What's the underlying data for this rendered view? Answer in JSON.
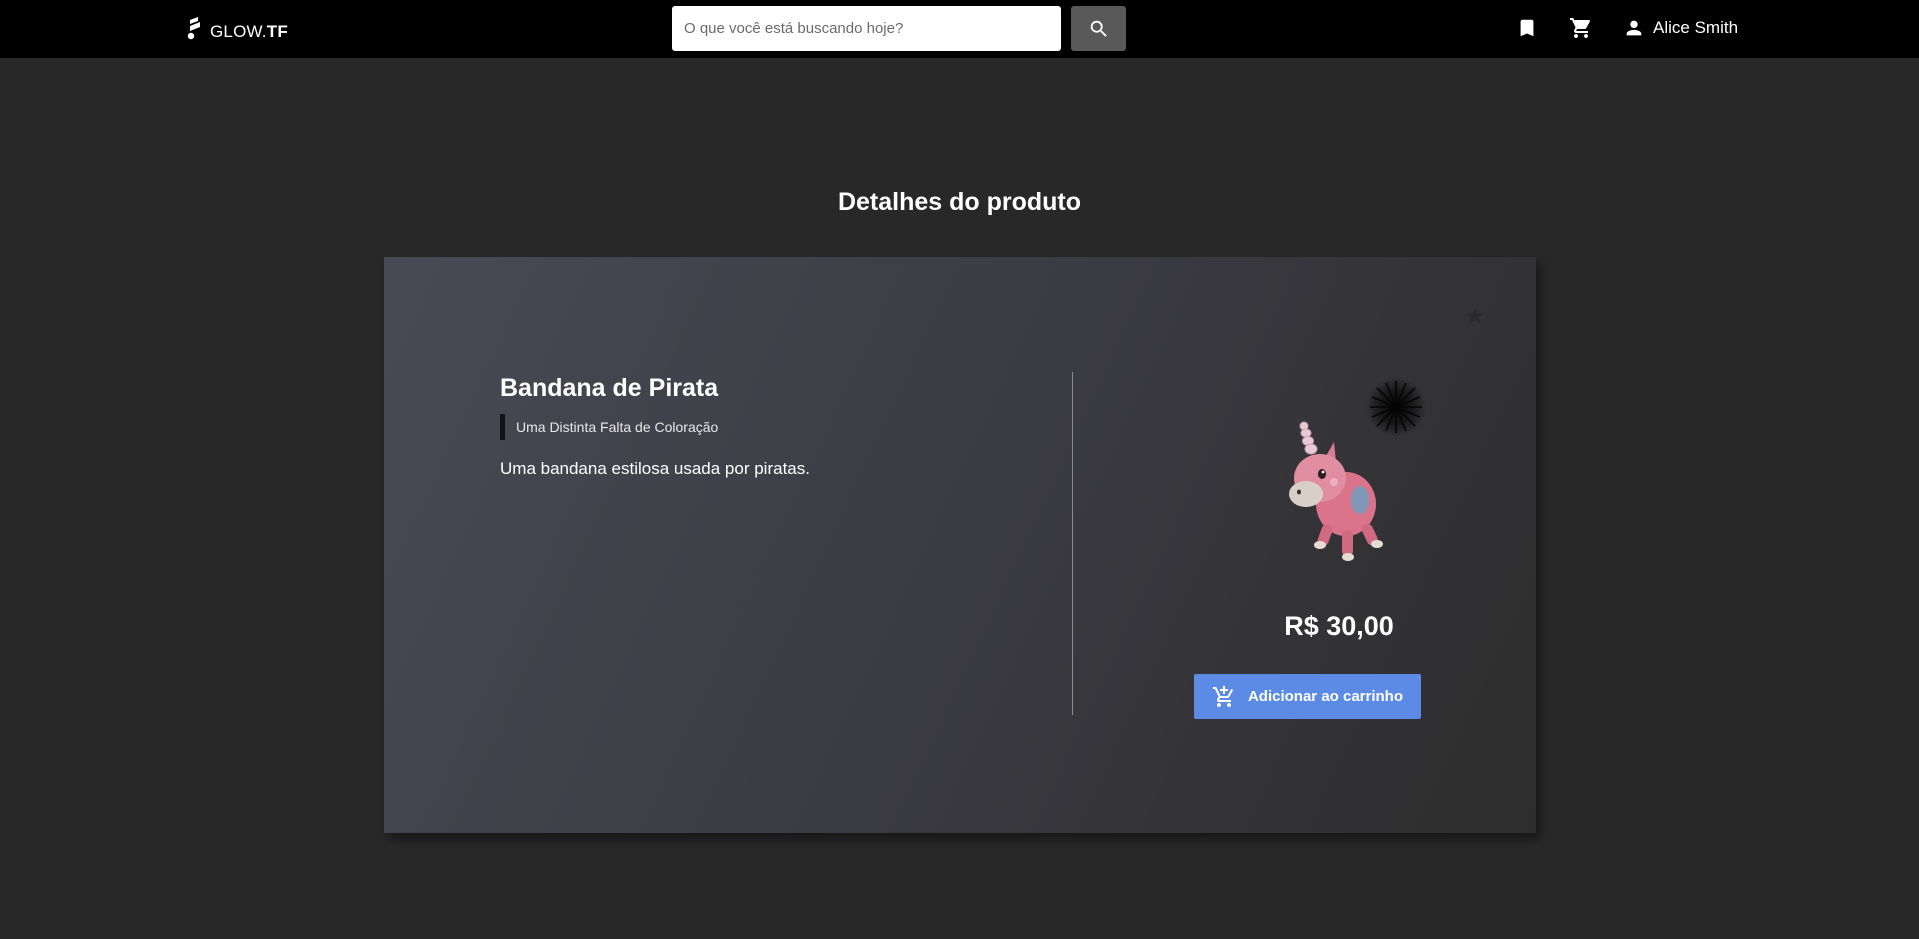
{
  "header": {
    "logo_text": "GLOW.",
    "logo_text_bold": "TF",
    "search_placeholder": "O que você está buscando hoje?",
    "user_name": "Alice Smith"
  },
  "page": {
    "title": "Detalhes do produto"
  },
  "product": {
    "name": "Bandana de Pirata",
    "quality": "Uma Distinta Falta de Coloração",
    "description": "Uma bandana estilosa usada por piratas.",
    "price": "R$ 30,00",
    "add_to_cart_label": "Adicionar ao carrinho"
  },
  "colors": {
    "topbar": "#000000",
    "background": "#282828",
    "accent_button": "#5c8be5",
    "search_button": "#595959"
  },
  "icons": {
    "logo": "glow-logo-icon",
    "search": "search-icon",
    "bookmark": "bookmark-icon",
    "cart": "cart-icon",
    "user": "person-icon",
    "favorite": "star-icon",
    "add_to_cart": "add-shopping-cart-icon"
  }
}
